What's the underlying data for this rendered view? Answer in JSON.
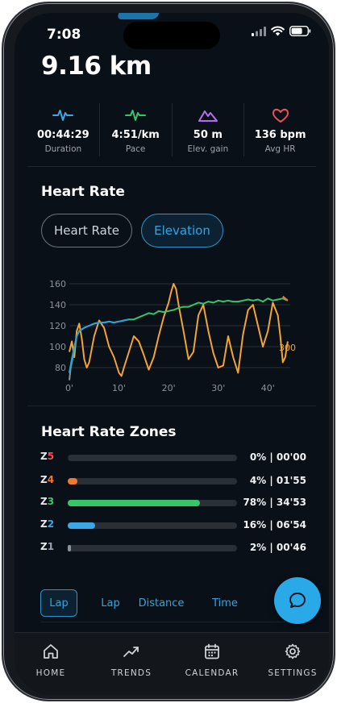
{
  "status": {
    "time": "7:08"
  },
  "summary": {
    "distance": "9.16 km"
  },
  "stats": [
    {
      "icon": "pulse-icon",
      "color": "#3aa8e6",
      "value": "00:44:29",
      "label": "Duration"
    },
    {
      "icon": "pace-pulse-icon",
      "color": "#36c66a",
      "value": "4:51/km",
      "label": "Pace"
    },
    {
      "icon": "mountain-icon",
      "color": "#b66ef0",
      "value": "50 m",
      "label": "Elev. gain"
    },
    {
      "icon": "heart-icon",
      "color": "#f0505a",
      "value": "136 bpm",
      "label": "Avg HR"
    }
  ],
  "heart_rate": {
    "title": "Heart Rate",
    "pills": {
      "heart_rate": "Heart Rate",
      "elevation": "Elevation"
    }
  },
  "chart_data": {
    "type": "line",
    "y_ticks": [
      "160",
      "140",
      "120",
      "100",
      "80"
    ],
    "x_ticks": [
      "0'",
      "10'",
      "20'",
      "30'",
      "40'"
    ],
    "xlim": [
      0,
      44.5
    ],
    "ylim": [
      70,
      160
    ],
    "right_axis_label": "300",
    "series": [
      {
        "color": "#f2a531",
        "x": [
          0,
          0.5,
          1,
          1.5,
          2,
          2.5,
          3,
          3.5,
          4,
          5,
          6,
          7,
          8,
          9,
          10,
          10.5,
          11,
          12,
          13,
          14,
          15,
          16,
          17,
          18,
          19,
          20,
          20.5,
          21,
          21.5,
          22,
          23,
          24,
          25,
          26,
          27,
          28,
          29,
          30,
          31,
          32,
          33,
          34,
          35,
          36,
          37,
          38,
          39,
          40,
          41,
          42,
          42.5,
          43,
          43.5,
          44
        ],
        "y": [
          95,
          105,
          90,
          115,
          122,
          108,
          88,
          80,
          85,
          110,
          125,
          118,
          100,
          90,
          75,
          72,
          80,
          95,
          110,
          105,
          92,
          78,
          90,
          110,
          128,
          142,
          152,
          160,
          155,
          140,
          115,
          88,
          95,
          130,
          140,
          115,
          94,
          80,
          82,
          110,
          90,
          75,
          112,
          135,
          140,
          120,
          100,
          115,
          142,
          130,
          110,
          85,
          90,
          105
        ]
      },
      {
        "color": "#36c66a",
        "x": [
          0,
          0.5,
          1,
          1.5,
          2,
          3,
          4,
          5,
          6,
          7,
          8,
          9,
          10,
          11,
          12,
          13,
          14,
          15,
          16,
          17,
          18,
          19,
          20,
          21,
          22,
          23,
          24,
          25,
          26,
          27,
          28,
          29,
          30,
          31,
          32,
          33,
          34,
          35,
          36,
          37,
          38,
          39,
          40,
          41,
          42,
          43,
          44
        ],
        "y": [
          75,
          85,
          98,
          110,
          115,
          118,
          120,
          122,
          123,
          123,
          124,
          123,
          124,
          125,
          126,
          126,
          128,
          130,
          132,
          131,
          134,
          133,
          134,
          135,
          137,
          138,
          138,
          140,
          142,
          141,
          143,
          142,
          144,
          143,
          144,
          143,
          143,
          144,
          145,
          144,
          145,
          143,
          146,
          144,
          145,
          146,
          144
        ]
      },
      {
        "color": "#2f9fe0",
        "x": [
          0,
          0.5,
          1,
          1.5,
          2,
          3,
          4,
          5,
          6,
          7,
          8,
          9,
          10,
          11,
          12
        ],
        "y": [
          75,
          88,
          100,
          110,
          115,
          118,
          120,
          122,
          123,
          123,
          124,
          123,
          124,
          125,
          126
        ]
      }
    ]
  },
  "zones": {
    "title": "Heart Rate Zones",
    "items": [
      {
        "name": "Z",
        "num": "5",
        "num_color": "#f0505a",
        "value": "0% | 00'00",
        "percent": 0,
        "color": "#f0505a"
      },
      {
        "name": "Z",
        "num": "4",
        "num_color": "#f07a2a",
        "value": "4% | 01'55",
        "percent": 4,
        "color": "#f07a2a"
      },
      {
        "name": "Z",
        "num": "3",
        "num_color": "#36c66a",
        "value": "78% | 34'53",
        "percent": 78,
        "color": "#36c66a"
      },
      {
        "name": "Z",
        "num": "2",
        "num_color": "#3aa8e6",
        "value": "16% | 06'54",
        "percent": 16,
        "color": "#3aa8e6"
      },
      {
        "name": "Z",
        "num": "1",
        "num_color": "#9aa4ae",
        "value": "2% | 00'46",
        "percent": 2,
        "color": "#8a939c"
      }
    ]
  },
  "laps": {
    "tabs": [
      "Lap",
      "Lap",
      "Distance",
      "Time"
    ]
  },
  "nav": {
    "home": "HOME",
    "trends": "TRENDS",
    "calendar": "CALENDAR",
    "settings": "SETTINGS"
  }
}
